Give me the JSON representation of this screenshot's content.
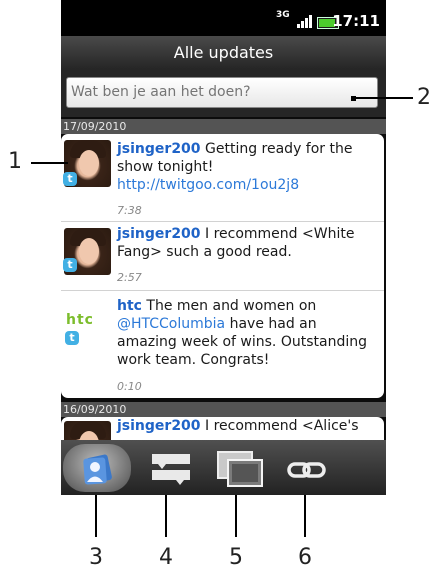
{
  "status_bar": {
    "network": "3G",
    "time": "17:11",
    "battery_fill": 0.9
  },
  "header": {
    "title": "Alle updates"
  },
  "compose": {
    "placeholder": "Wat ben je aan het doen?"
  },
  "dates": [
    "17/09/2010",
    "16/09/2010"
  ],
  "tweets": [
    {
      "user": "jsinger200",
      "text": "Getting ready for the show tonight!",
      "link": "http://twitgoo.com/1ou2j8",
      "time": "7:38"
    },
    {
      "user": "jsinger200",
      "text": "I recommend <White Fang>  such a good read.",
      "time": "2:57"
    },
    {
      "user": "htc",
      "text_pre": "The men and women on",
      "mention": "@HTCColumbia",
      "text_post": "have had an amazing week of wins. Outstanding work team. Congrats!",
      "time": "0:10"
    },
    {
      "user": "jsinger200",
      "text": "I recommend <Alice's"
    }
  ],
  "brand": {
    "htc_logo": "htc",
    "twitter_badge": "t"
  },
  "tabs": [
    {
      "id": "people",
      "icon": "people-icon",
      "active": true
    },
    {
      "id": "updates",
      "icon": "updates-icon",
      "active": false
    },
    {
      "id": "photos",
      "icon": "photos-icon",
      "active": false
    },
    {
      "id": "links",
      "icon": "link-icon",
      "active": false
    }
  ],
  "callouts": [
    "1",
    "2",
    "3",
    "4",
    "5",
    "6"
  ],
  "colors": {
    "username": "#1f63c7",
    "link": "#2c79d8",
    "htc_green": "#7cbd2c",
    "battery": "#4ccc2e"
  }
}
